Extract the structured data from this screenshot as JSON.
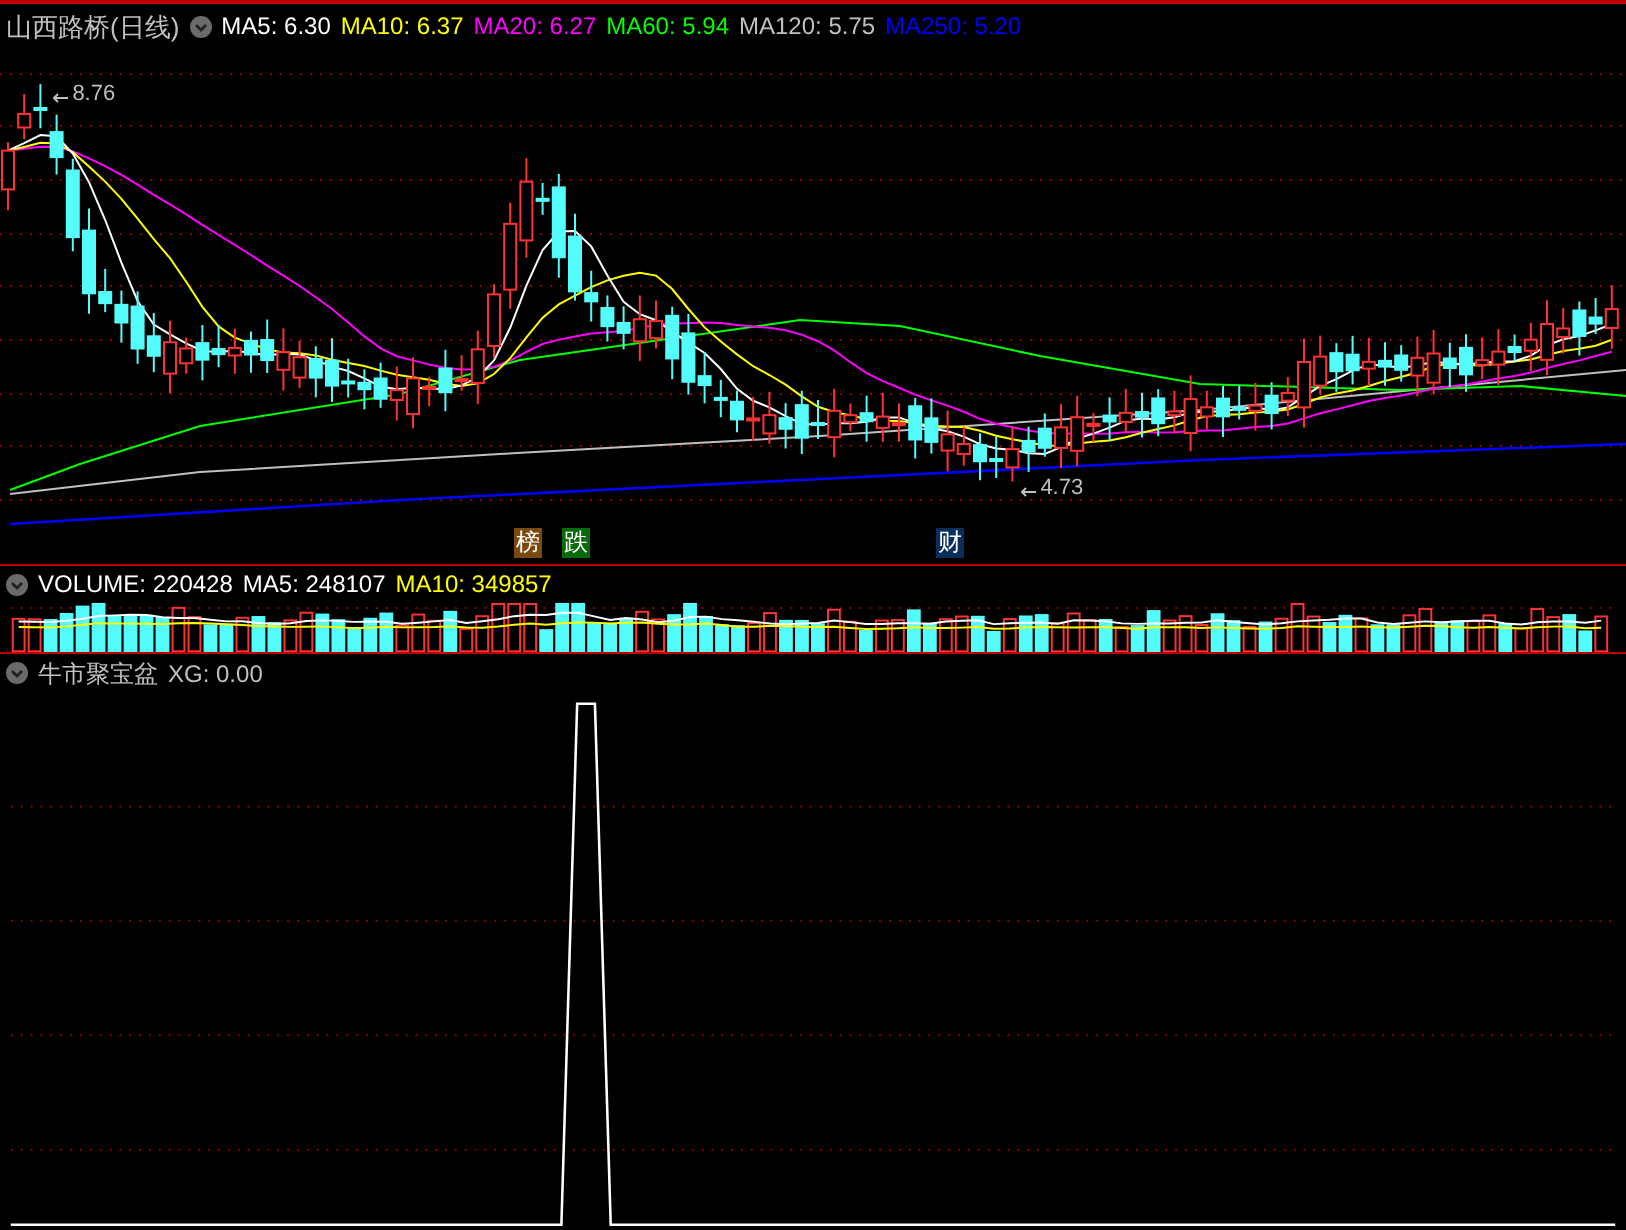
{
  "main_panel": {
    "title": "山西路桥(日线)",
    "indicators": [
      {
        "label": "MA5: 6.30",
        "color": "#ffffff"
      },
      {
        "label": "MA10: 6.37",
        "color": "#ffff00"
      },
      {
        "label": "MA20: 6.27",
        "color": "#ff00ff"
      },
      {
        "label": "MA60: 5.94",
        "color": "#00ff00"
      },
      {
        "label": "MA120: 5.75",
        "color": "#c0c0c0"
      },
      {
        "label": "MA250: 5.20",
        "color": "#0000ff"
      }
    ],
    "high_label": "8.76",
    "low_label": "4.73",
    "markers": [
      {
        "text": "榜",
        "color": "#7a4a10"
      },
      {
        "text": "跌",
        "color": "#0a6a0a"
      },
      {
        "text": "财",
        "color": "#0a2e5a"
      }
    ]
  },
  "volume_panel": {
    "indicators": [
      {
        "label": "VOLUME: 220428",
        "color": "#ffffff"
      },
      {
        "label": "MA5: 248107",
        "color": "#ffffff"
      },
      {
        "label": "MA10: 349857",
        "color": "#ffff00"
      }
    ]
  },
  "xg_panel": {
    "indicators": [
      {
        "label": "牛市聚宝盆",
        "color": "#c0c0c0"
      },
      {
        "label": "XG: 0.00",
        "color": "#c0c0c0"
      }
    ]
  }
}
